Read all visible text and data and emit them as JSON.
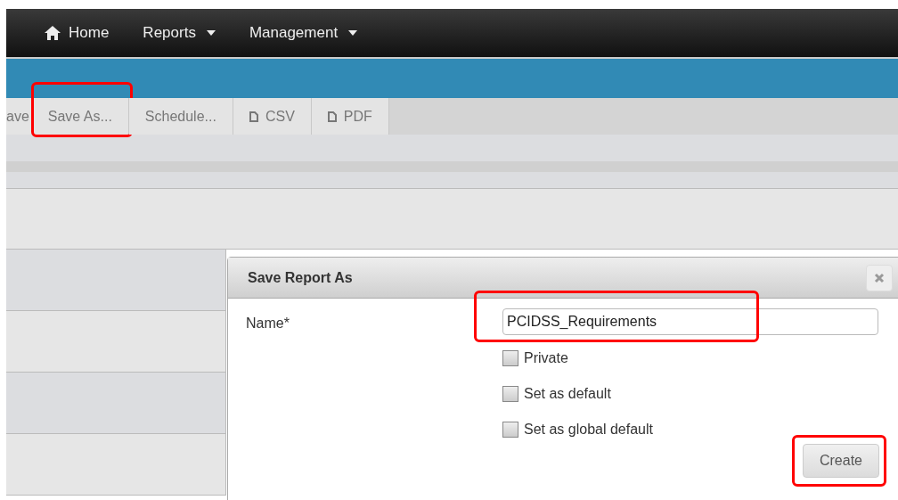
{
  "nav": [
    {
      "label": "Home",
      "kind": "home"
    },
    {
      "label": "Reports",
      "kind": "dropdown"
    },
    {
      "label": "Management",
      "kind": "dropdown"
    }
  ],
  "toolbar": [
    {
      "label": "ave",
      "kind": "text",
      "highlighted": false
    },
    {
      "label": "Save As...",
      "kind": "text",
      "highlighted": true
    },
    {
      "label": "Schedule...",
      "kind": "text",
      "highlighted": false
    },
    {
      "label": "CSV",
      "kind": "file",
      "highlighted": false
    },
    {
      "label": "PDF",
      "kind": "file",
      "highlighted": false
    }
  ],
  "dialog": {
    "title": "Save Report As",
    "name_label": "Name*",
    "name_value": "PCIDSS_Requirements",
    "name_highlighted": true,
    "options": [
      {
        "label": "Private",
        "checked": false
      },
      {
        "label": "Set as default",
        "checked": false
      },
      {
        "label": "Set as global default",
        "checked": false
      }
    ],
    "create_button": "Create",
    "create_highlighted": true
  }
}
